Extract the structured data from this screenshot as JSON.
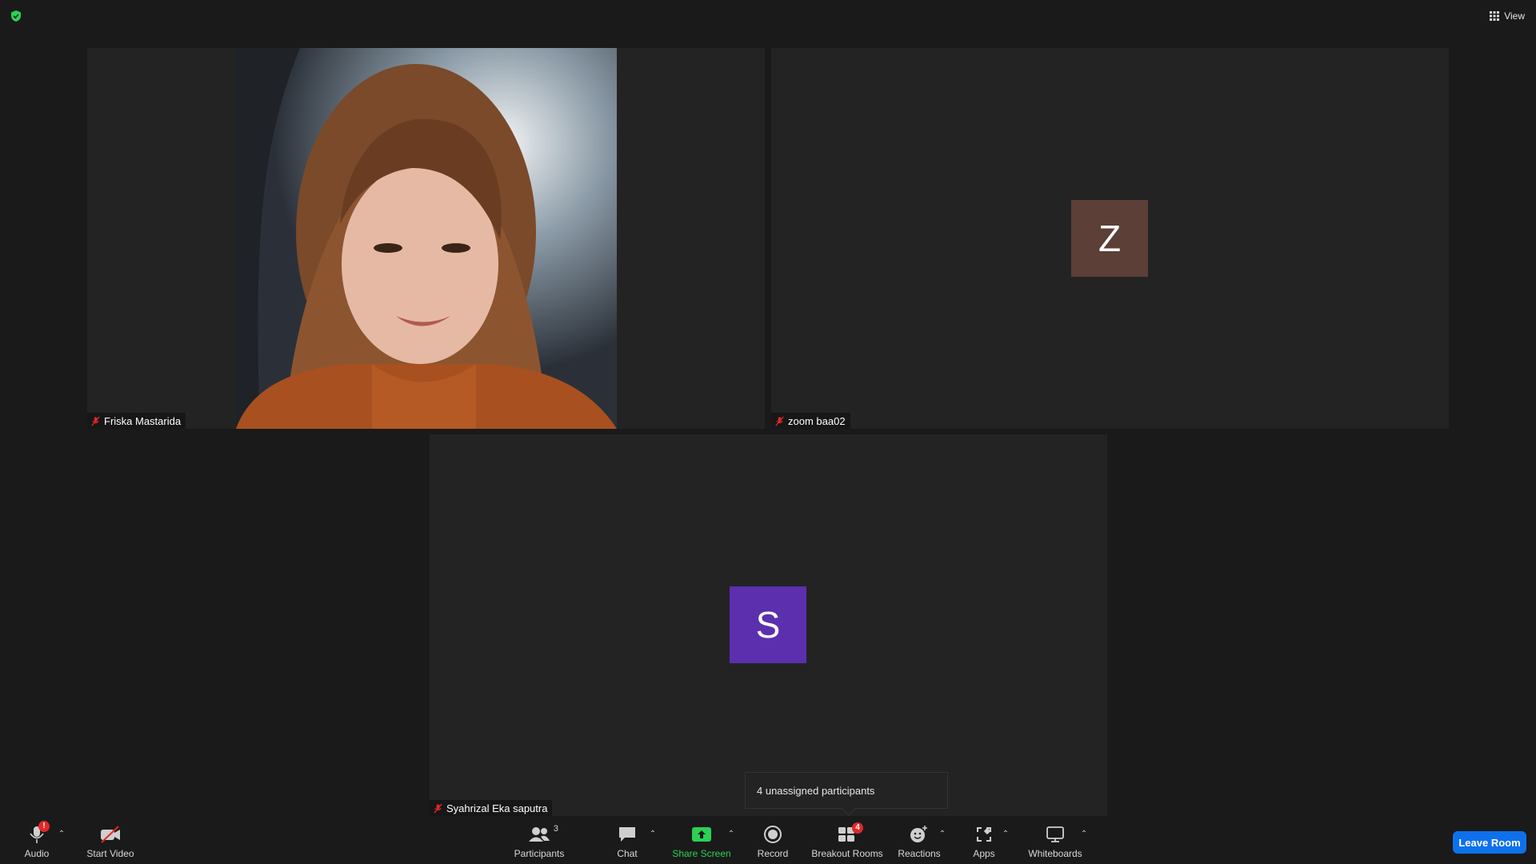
{
  "top": {
    "view_label": "View",
    "shield_color": "#2ad154"
  },
  "participants": [
    {
      "name": "Friska Mastarida",
      "muted": true,
      "video": true
    },
    {
      "name": "zoom baa02",
      "muted": true,
      "video": false,
      "initial": "Z",
      "avatar_color": "#5c3f37"
    },
    {
      "name": "Syahrizal Eka saputra",
      "muted": true,
      "video": false,
      "initial": "S",
      "avatar_color": "#5c2fae"
    }
  ],
  "tooltip": {
    "text": "4 unassigned participants"
  },
  "toolbar": {
    "audio": {
      "label": "Audio",
      "badge": "!"
    },
    "video": {
      "label": "Start Video"
    },
    "participants": {
      "label": "Participants",
      "count": "3"
    },
    "chat": {
      "label": "Chat"
    },
    "share": {
      "label": "Share Screen",
      "color": "#2ad154"
    },
    "record": {
      "label": "Record"
    },
    "breakout": {
      "label": "Breakout Rooms",
      "badge": "4"
    },
    "reactions": {
      "label": "Reactions"
    },
    "apps": {
      "label": "Apps"
    },
    "whiteboards": {
      "label": "Whiteboards"
    },
    "leave": {
      "label": "Leave Room",
      "color": "#0e71eb"
    }
  }
}
